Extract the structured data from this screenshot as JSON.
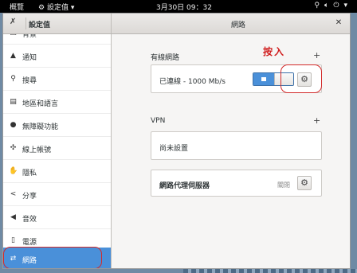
{
  "topbar": {
    "activities": "概覽",
    "app_menu": "設定值",
    "clock": "3月30日 09：32",
    "icons": [
      "network-icon",
      "volume-icon",
      "power-icon",
      "chevron-down-icon"
    ]
  },
  "headerbar": {
    "left_title": "設定值",
    "title": "網路"
  },
  "sidebar": {
    "items": [
      {
        "label": "背景",
        "icon": "background-icon"
      },
      {
        "label": "通知",
        "icon": "bell-icon"
      },
      {
        "label": "搜尋",
        "icon": "search-icon"
      },
      {
        "label": "地區和語言",
        "icon": "region-icon"
      },
      {
        "label": "無障礙功能",
        "icon": "accessibility-icon"
      },
      {
        "label": "線上帳號",
        "icon": "online-accounts-icon"
      },
      {
        "label": "隱私",
        "icon": "privacy-icon"
      },
      {
        "label": "分享",
        "icon": "share-icon"
      },
      {
        "label": "音效",
        "icon": "sound-icon"
      },
      {
        "label": "電源",
        "icon": "power-icon"
      },
      {
        "label": "網路",
        "icon": "network-icon",
        "selected": true
      }
    ]
  },
  "wired": {
    "title": "有線網路",
    "add": "+",
    "status": "已連線 - 1000 Mb/s",
    "toggle_on": true
  },
  "vpn": {
    "title": "VPN",
    "add": "+",
    "empty": "尚未設置"
  },
  "proxy": {
    "label": "網路代理伺服器",
    "status": "關閉"
  },
  "annotation": {
    "text": "按入",
    "color": "#d01c1c"
  },
  "colors": {
    "accent": "#4a90d9",
    "annotation": "#d32a2a"
  }
}
